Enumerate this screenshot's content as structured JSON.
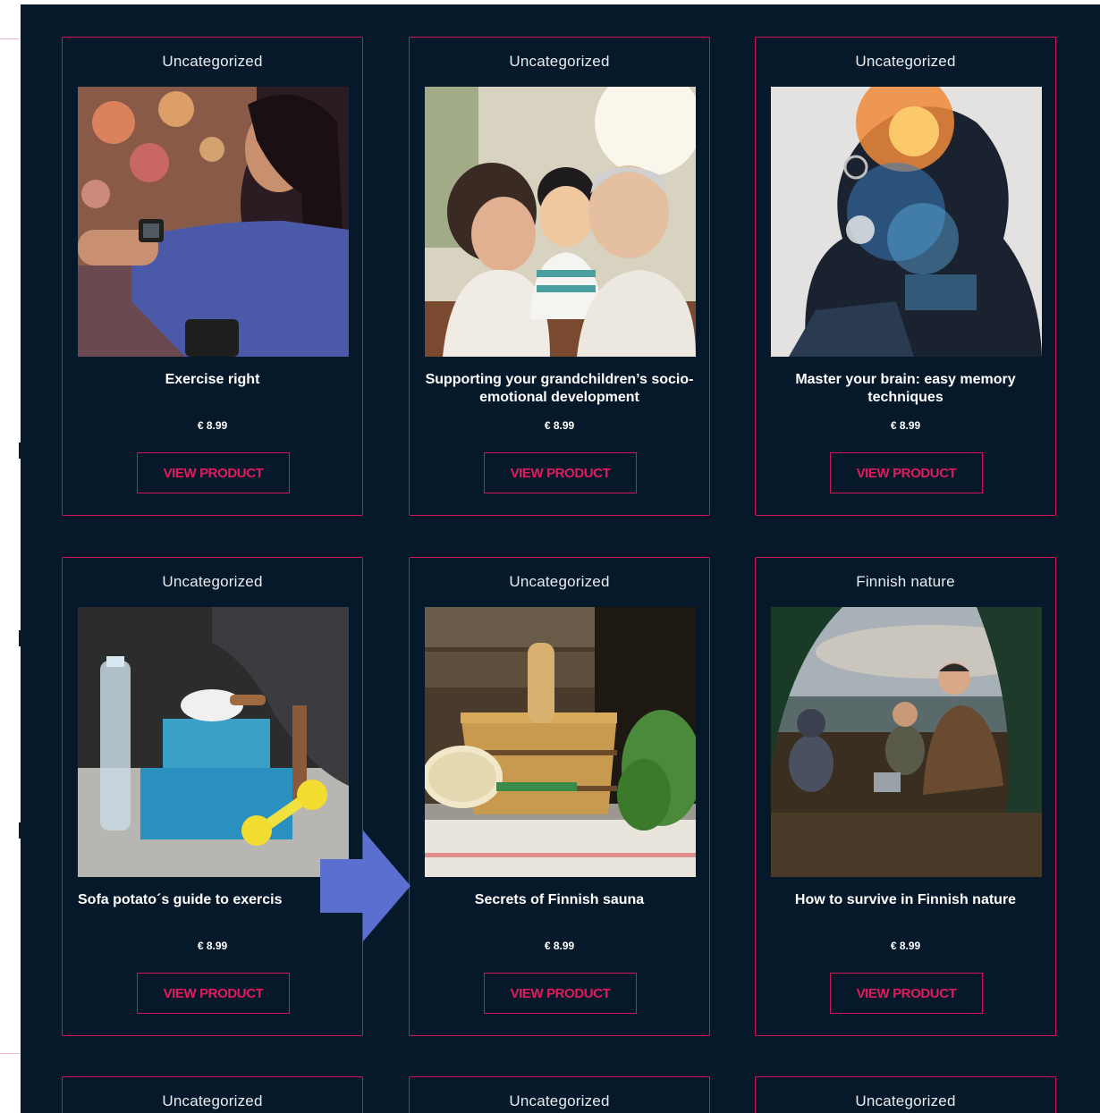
{
  "cards": [
    {
      "category": "Uncategorized",
      "title": "Exercise right",
      "price": "€ 8.99",
      "button": "VIEW PRODUCT"
    },
    {
      "category": "Uncategorized",
      "title": "Supporting your grandchildren’s socio-emotional development",
      "price": "€ 8.99",
      "button": "VIEW PRODUCT"
    },
    {
      "category": "Uncategorized",
      "title": "Master your brain: easy memory techniques",
      "price": "€ 8.99",
      "button": "VIEW PRODUCT"
    },
    {
      "category": "Uncategorized",
      "title": "Sofa potato´s guide to exercis",
      "price": "€ 8.99",
      "button": "VIEW PRODUCT"
    },
    {
      "category": "Uncategorized",
      "title": "Secrets of Finnish sauna",
      "price": "€ 8.99",
      "button": "VIEW PRODUCT"
    },
    {
      "category": "Finnish nature",
      "title": "How to survive in Finnish nature",
      "price": "€ 8.99",
      "button": "VIEW PRODUCT"
    },
    {
      "category": "Uncategorized"
    },
    {
      "category": "Uncategorized"
    },
    {
      "category": "Uncategorized"
    }
  ],
  "colors": {
    "background": "#06192a",
    "accent": "#d4145a",
    "arrow": "#5a6fcf"
  },
  "overlay": {
    "icon": "right-arrow-icon"
  }
}
